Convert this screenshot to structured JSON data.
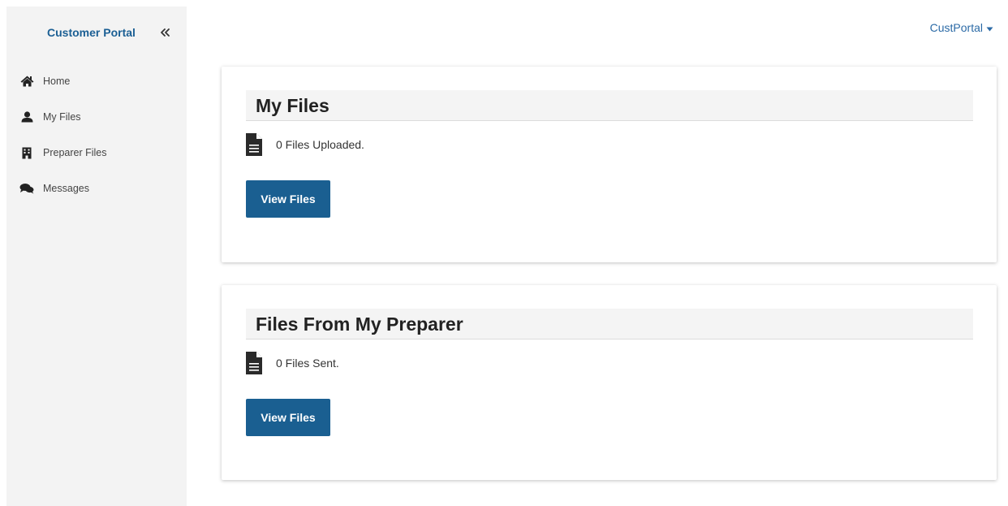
{
  "sidebar": {
    "brand": "Customer Portal",
    "collapse_icon": "double-chevron-left-icon",
    "items": [
      {
        "label": "Home",
        "icon": "home-icon"
      },
      {
        "label": "My Files",
        "icon": "user-icon"
      },
      {
        "label": "Preparer Files",
        "icon": "building-icon"
      },
      {
        "label": "Messages",
        "icon": "chat-icon"
      }
    ]
  },
  "header": {
    "user_menu_label": "CustPortal",
    "user_menu_icon": "caret-down-icon"
  },
  "cards": [
    {
      "title": "My Files",
      "status_text": "0 Files Uploaded.",
      "button_label": "View Files",
      "icon": "document-icon"
    },
    {
      "title": "Files From My Preparer",
      "status_text": "0 Files Sent.",
      "button_label": "View Files",
      "icon": "document-icon"
    }
  ],
  "colors": {
    "brand": "#1b5f94",
    "button": "#1a5f91",
    "sidebar_bg": "#f3f3f3",
    "link": "#2b6aa6"
  }
}
